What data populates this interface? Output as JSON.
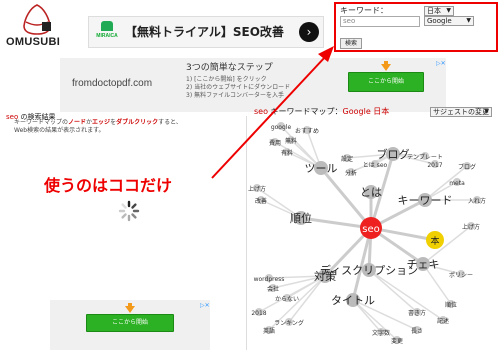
{
  "logo": {
    "text": "OMUSUBI"
  },
  "ad_top": {
    "brand": "MIRAICA",
    "text": "【無料トライアル】SEO改善",
    "arrow": "›"
  },
  "keyword_box": {
    "label": "キーワード：",
    "input_placeholder": "seo",
    "lang_select": "日本",
    "engine_select": "Google",
    "search_button": "検索"
  },
  "ad_second": {
    "domain": "fromdoctopdf.com",
    "steps_title": "3つの簡単なステップ",
    "steps": [
      "1) [ここから開始] をクリック",
      "2) 当社のウェブサイトにダウンロード",
      "3) 無料ファイルコンバーターを入手"
    ],
    "button": "ここから開始"
  },
  "results": {
    "keyword": "seo",
    "title_suffix": " の検索結果",
    "desc_part1": "キーワードマップの",
    "desc_node": "ノード",
    "desc_or": "か",
    "desc_edge": "エッジ",
    "desc_wo": "を",
    "desc_dbl": "ダブルクリック",
    "desc_part2": "すると、",
    "desc_line2": "Web検索の結果が表示されます。"
  },
  "annotation": {
    "text": "使うのはココだけ",
    "color": "#e00000"
  },
  "keyword_map": {
    "keyword": "seo",
    "label": " キーワードマップ：",
    "engine": "Google 日本",
    "suggest_select": "サジェストの変更",
    "center": "seo",
    "hubs": [
      "ツール",
      "ブログ",
      "とは",
      "キーワード",
      "順位",
      "チェキ",
      "対策",
      "ディスクリプション",
      "タイトル",
      "本"
    ],
    "leaves": [
      "google",
      "おすすめ",
      "無料",
      "有料",
      "費用",
      "設定",
      "とは seo",
      "分析",
      "テンプレート",
      "2017",
      "wordpress",
      "meta",
      "ブログ",
      "上げ方",
      "会社",
      "改善",
      "からない",
      "ランキング",
      "2018",
      "英語",
      "入れ方",
      "ポリシー",
      "順位",
      "文字数",
      "長さ",
      "変更",
      "書き方",
      "記述",
      "上げ方"
    ]
  },
  "ad_bottom": {
    "button": "ここから開始"
  },
  "colors": {
    "accent_red": "#e00000",
    "center_node": "#ee2020",
    "highlight_node": "#f0d000",
    "button_green": "#2cb024"
  }
}
